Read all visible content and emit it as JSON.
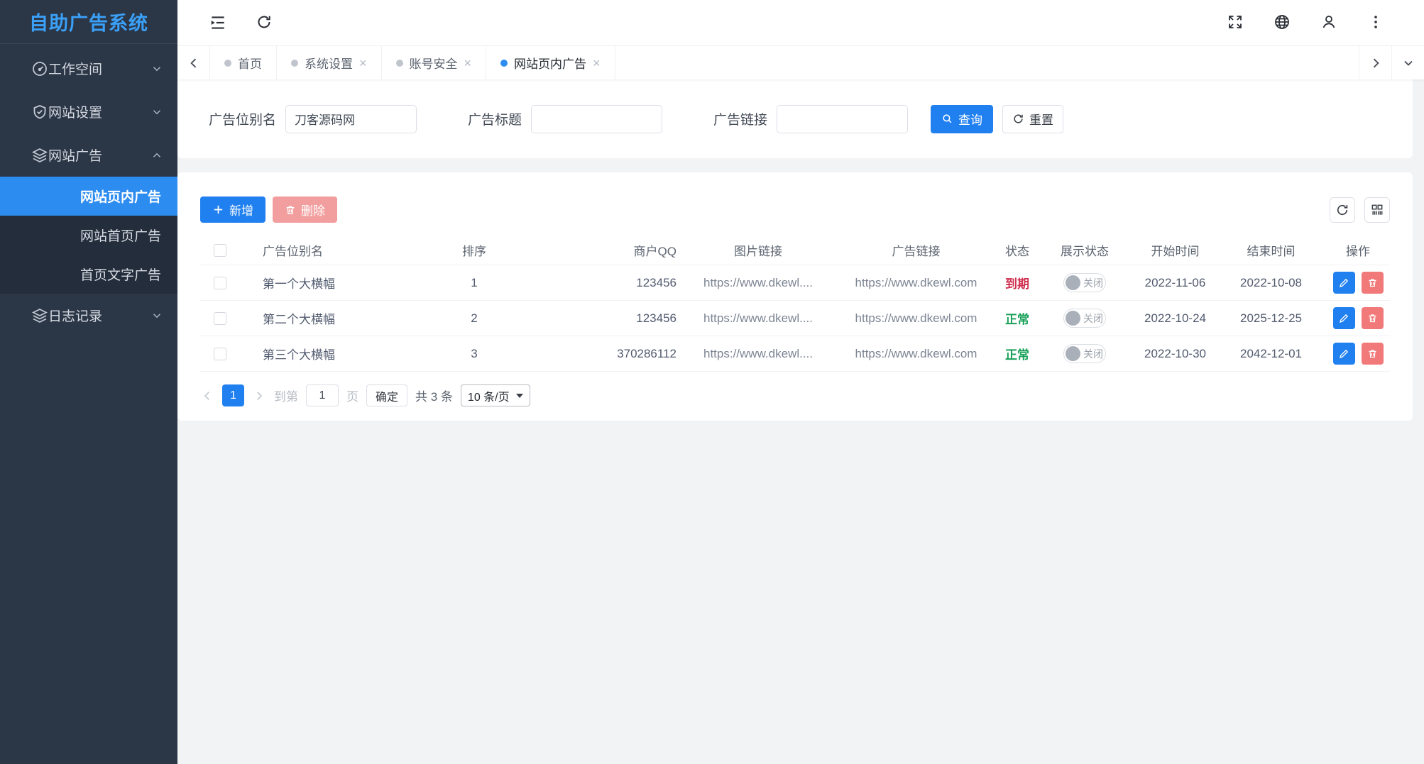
{
  "app": {
    "title": "自助广告系统"
  },
  "colors": {
    "accent": "#2080f0",
    "sidebar_bg": "#2b3646",
    "sidebar_active": "#2d8cf0",
    "delete_disabled": "#f29e9e",
    "delete_action": "#f1797a",
    "status_expired": "#d03050",
    "status_normal": "#18a058",
    "page_bg": "#f2f3f5"
  },
  "sidebar": {
    "items": [
      {
        "label": "工作空间",
        "icon": "dashboard-icon",
        "state": "collapsed"
      },
      {
        "label": "网站设置",
        "icon": "shield-check-icon",
        "state": "collapsed"
      },
      {
        "label": "网站广告",
        "icon": "layers-icon",
        "state": "expanded"
      },
      {
        "label": "日志记录",
        "icon": "log-stack-icon",
        "state": "collapsed"
      }
    ],
    "submenu": [
      {
        "label": "网站页内广告",
        "active": true
      },
      {
        "label": "网站首页广告",
        "active": false
      },
      {
        "label": "首页文字广告",
        "active": false
      }
    ]
  },
  "topbar": {
    "left_icons": [
      "menu-collapse-icon",
      "refresh-icon"
    ],
    "right_icons": [
      "fullscreen-icon",
      "globe-icon",
      "user-icon",
      "more-vertical-icon"
    ]
  },
  "tabs": [
    {
      "label": "首页",
      "active": false,
      "closable": false
    },
    {
      "label": "系统设置",
      "active": false,
      "closable": true
    },
    {
      "label": "账号安全",
      "active": false,
      "closable": true
    },
    {
      "label": "网站页内广告",
      "active": true,
      "closable": true
    }
  ],
  "tab_close_glyph": "×",
  "search": {
    "fields": [
      {
        "label": "广告位别名",
        "value": "刀客源码网"
      },
      {
        "label": "广告标题",
        "value": ""
      },
      {
        "label": "广告链接",
        "value": ""
      }
    ],
    "query_label": "查询",
    "reset_label": "重置"
  },
  "toolbar": {
    "add_label": "新增",
    "delete_label": "删除"
  },
  "table": {
    "columns": [
      "广告位别名",
      "排序",
      "商户QQ",
      "图片链接",
      "广告链接",
      "状态",
      "展示状态",
      "开始时间",
      "结束时间",
      "操作"
    ],
    "rows": [
      {
        "alias": "第一个大横幅",
        "order": "1",
        "qq": "123456",
        "image_link": "https://www.dkewl....",
        "ad_link": "https://www.dkewl.com",
        "status": "到期",
        "status_type": "expired",
        "display": "关闭",
        "start": "2022-11-06",
        "end": "2022-10-08"
      },
      {
        "alias": "第二个大横幅",
        "order": "2",
        "qq": "123456",
        "image_link": "https://www.dkewl....",
        "ad_link": "https://www.dkewl.com",
        "status": "正常",
        "status_type": "normal",
        "display": "关闭",
        "start": "2022-10-24",
        "end": "2025-12-25"
      },
      {
        "alias": "第三个大横幅",
        "order": "3",
        "qq": "370286112",
        "image_link": "https://www.dkewl....",
        "ad_link": "https://www.dkewl.com",
        "status": "正常",
        "status_type": "normal",
        "display": "关闭",
        "start": "2022-10-30",
        "end": "2042-12-01"
      }
    ]
  },
  "pagination": {
    "page": "1",
    "goto_prefix": "到第",
    "goto_value": "1",
    "goto_suffix": "页",
    "confirm_label": "确定",
    "total_label": "共 3 条",
    "page_size": "10 条/页"
  }
}
